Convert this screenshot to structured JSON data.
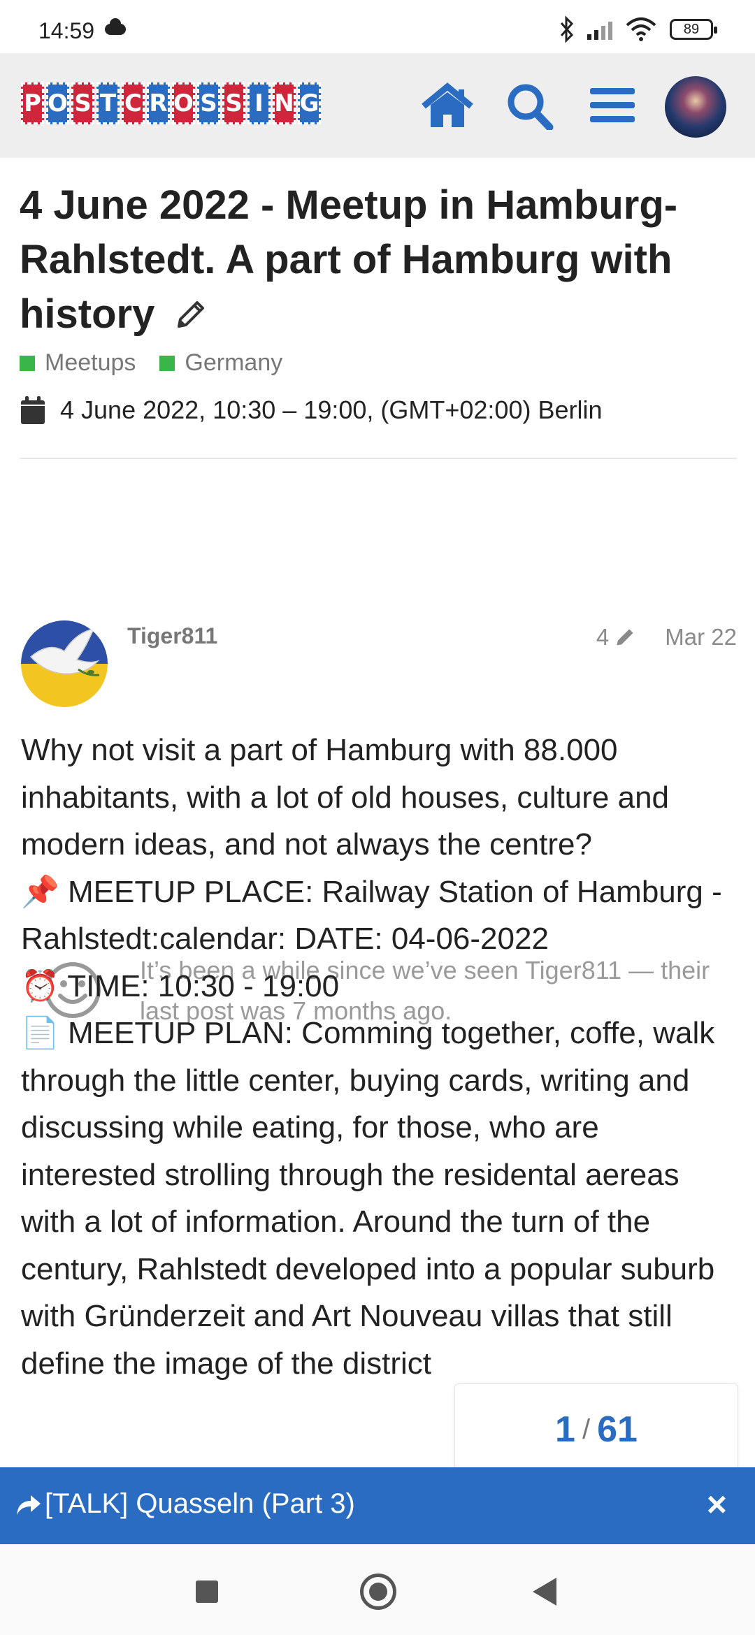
{
  "status_bar": {
    "time": "14:59",
    "battery": "89"
  },
  "header": {
    "logo_letters": [
      "P",
      "O",
      "S",
      "T",
      "C",
      "R",
      "O",
      "S",
      "S",
      "I",
      "N",
      "G"
    ],
    "logo_text": "POSTCROSSING"
  },
  "topic": {
    "title": "4 June 2022 - Meetup in Hamburg-Rahlstedt. A part of Hamburg with history",
    "categories": [
      "Meetups",
      "Germany"
    ],
    "event_datetime": "4 June 2022, 10:30 – 19:00, (GMT+02:00) Berlin"
  },
  "notice": {
    "text": "It’s been a while since we’ve seen Tiger811 — their last post was 7 months ago."
  },
  "post": {
    "username": "Tiger811",
    "edit_count": "4",
    "date": "Mar 22",
    "lines": [
      "Why not visit a part of Hamburg with 88.000 inhabitants, with a lot of old houses, culture and modern ideas, and not always the centre?",
      "📌 MEETUP PLACE: Railway Station of Hamburg -Rahlstedt:calendar: DATE: 04-06-2022",
      "⏰ TIME: 10:30 - 19:00",
      "📄 MEETUP PLAN: Comming together, coffe, walk through the little center, buying cards, writing and discussing while eating, for those, who are interested strolling through the residental aereas with a lot of information. Around the turn of the century, Rahlstedt developed into a popular suburb with Gründerzeit and Art Nouveau villas that still define the image of the district"
    ]
  },
  "progress": {
    "current": "1",
    "total": "61"
  },
  "suggested_topic": {
    "label": "[TALK] Quasseln (Part 3)",
    "close_glyph": "×"
  },
  "colors": {
    "brand_blue": "#2a6cc1",
    "brand_red": "#d0263b",
    "category_green": "#3ab54a"
  }
}
